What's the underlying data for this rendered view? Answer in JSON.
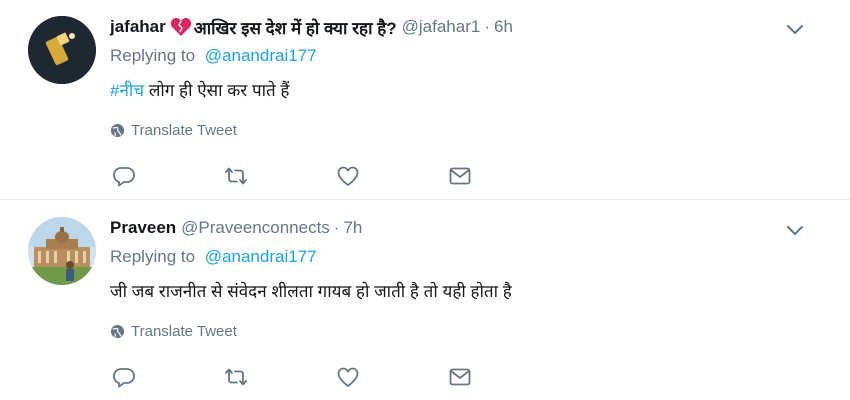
{
  "tweets": [
    {
      "name": "jafahar",
      "name_suffix": "आखिर इस देश में हो क्या रहा है?",
      "handle": "@jafahar1",
      "separator": "·",
      "time": "6h",
      "replying_prefix": "Replying to",
      "replying_to": "@anandrai177",
      "hashtag": "#नीच",
      "text": " लोग ही ऐसा कर पाते हैं",
      "translate_label": "Translate Tweet"
    },
    {
      "name": "Praveen",
      "handle": "@Praveenconnects",
      "separator": "·",
      "time": "7h",
      "replying_prefix": "Replying to",
      "replying_to": "@anandrai177",
      "text": "जी जब राजनीत से संवेदन शीलता गायब हो जाती है तो यही होता है",
      "translate_label": "Translate Tweet"
    }
  ],
  "icons": {
    "caret": "chevron-down-icon",
    "globe": "globe-icon",
    "reply": "reply-icon",
    "retweet": "retweet-icon",
    "like": "heart-icon",
    "dm": "envelope-icon"
  },
  "colors": {
    "link": "#1da1f2",
    "muted": "#657786",
    "text": "#14171a",
    "heart_emoji": "#e0245e"
  }
}
